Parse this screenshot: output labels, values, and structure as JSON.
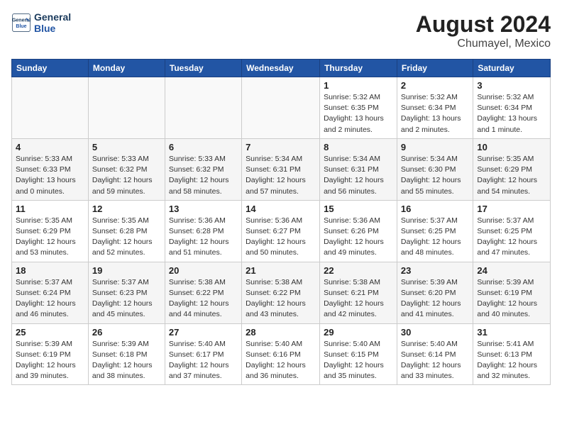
{
  "header": {
    "logo_line1": "General",
    "logo_line2": "Blue",
    "month_year": "August 2024",
    "location": "Chumayel, Mexico"
  },
  "weekdays": [
    "Sunday",
    "Monday",
    "Tuesday",
    "Wednesday",
    "Thursday",
    "Friday",
    "Saturday"
  ],
  "weeks": [
    [
      {
        "day": "",
        "info": ""
      },
      {
        "day": "",
        "info": ""
      },
      {
        "day": "",
        "info": ""
      },
      {
        "day": "",
        "info": ""
      },
      {
        "day": "1",
        "info": "Sunrise: 5:32 AM\nSunset: 6:35 PM\nDaylight: 13 hours\nand 2 minutes."
      },
      {
        "day": "2",
        "info": "Sunrise: 5:32 AM\nSunset: 6:34 PM\nDaylight: 13 hours\nand 2 minutes."
      },
      {
        "day": "3",
        "info": "Sunrise: 5:32 AM\nSunset: 6:34 PM\nDaylight: 13 hours\nand 1 minute."
      }
    ],
    [
      {
        "day": "4",
        "info": "Sunrise: 5:33 AM\nSunset: 6:33 PM\nDaylight: 13 hours\nand 0 minutes."
      },
      {
        "day": "5",
        "info": "Sunrise: 5:33 AM\nSunset: 6:32 PM\nDaylight: 12 hours\nand 59 minutes."
      },
      {
        "day": "6",
        "info": "Sunrise: 5:33 AM\nSunset: 6:32 PM\nDaylight: 12 hours\nand 58 minutes."
      },
      {
        "day": "7",
        "info": "Sunrise: 5:34 AM\nSunset: 6:31 PM\nDaylight: 12 hours\nand 57 minutes."
      },
      {
        "day": "8",
        "info": "Sunrise: 5:34 AM\nSunset: 6:31 PM\nDaylight: 12 hours\nand 56 minutes."
      },
      {
        "day": "9",
        "info": "Sunrise: 5:34 AM\nSunset: 6:30 PM\nDaylight: 12 hours\nand 55 minutes."
      },
      {
        "day": "10",
        "info": "Sunrise: 5:35 AM\nSunset: 6:29 PM\nDaylight: 12 hours\nand 54 minutes."
      }
    ],
    [
      {
        "day": "11",
        "info": "Sunrise: 5:35 AM\nSunset: 6:29 PM\nDaylight: 12 hours\nand 53 minutes."
      },
      {
        "day": "12",
        "info": "Sunrise: 5:35 AM\nSunset: 6:28 PM\nDaylight: 12 hours\nand 52 minutes."
      },
      {
        "day": "13",
        "info": "Sunrise: 5:36 AM\nSunset: 6:28 PM\nDaylight: 12 hours\nand 51 minutes."
      },
      {
        "day": "14",
        "info": "Sunrise: 5:36 AM\nSunset: 6:27 PM\nDaylight: 12 hours\nand 50 minutes."
      },
      {
        "day": "15",
        "info": "Sunrise: 5:36 AM\nSunset: 6:26 PM\nDaylight: 12 hours\nand 49 minutes."
      },
      {
        "day": "16",
        "info": "Sunrise: 5:37 AM\nSunset: 6:25 PM\nDaylight: 12 hours\nand 48 minutes."
      },
      {
        "day": "17",
        "info": "Sunrise: 5:37 AM\nSunset: 6:25 PM\nDaylight: 12 hours\nand 47 minutes."
      }
    ],
    [
      {
        "day": "18",
        "info": "Sunrise: 5:37 AM\nSunset: 6:24 PM\nDaylight: 12 hours\nand 46 minutes."
      },
      {
        "day": "19",
        "info": "Sunrise: 5:37 AM\nSunset: 6:23 PM\nDaylight: 12 hours\nand 45 minutes."
      },
      {
        "day": "20",
        "info": "Sunrise: 5:38 AM\nSunset: 6:22 PM\nDaylight: 12 hours\nand 44 minutes."
      },
      {
        "day": "21",
        "info": "Sunrise: 5:38 AM\nSunset: 6:22 PM\nDaylight: 12 hours\nand 43 minutes."
      },
      {
        "day": "22",
        "info": "Sunrise: 5:38 AM\nSunset: 6:21 PM\nDaylight: 12 hours\nand 42 minutes."
      },
      {
        "day": "23",
        "info": "Sunrise: 5:39 AM\nSunset: 6:20 PM\nDaylight: 12 hours\nand 41 minutes."
      },
      {
        "day": "24",
        "info": "Sunrise: 5:39 AM\nSunset: 6:19 PM\nDaylight: 12 hours\nand 40 minutes."
      }
    ],
    [
      {
        "day": "25",
        "info": "Sunrise: 5:39 AM\nSunset: 6:19 PM\nDaylight: 12 hours\nand 39 minutes."
      },
      {
        "day": "26",
        "info": "Sunrise: 5:39 AM\nSunset: 6:18 PM\nDaylight: 12 hours\nand 38 minutes."
      },
      {
        "day": "27",
        "info": "Sunrise: 5:40 AM\nSunset: 6:17 PM\nDaylight: 12 hours\nand 37 minutes."
      },
      {
        "day": "28",
        "info": "Sunrise: 5:40 AM\nSunset: 6:16 PM\nDaylight: 12 hours\nand 36 minutes."
      },
      {
        "day": "29",
        "info": "Sunrise: 5:40 AM\nSunset: 6:15 PM\nDaylight: 12 hours\nand 35 minutes."
      },
      {
        "day": "30",
        "info": "Sunrise: 5:40 AM\nSunset: 6:14 PM\nDaylight: 12 hours\nand 33 minutes."
      },
      {
        "day": "31",
        "info": "Sunrise: 5:41 AM\nSunset: 6:13 PM\nDaylight: 12 hours\nand 32 minutes."
      }
    ]
  ]
}
